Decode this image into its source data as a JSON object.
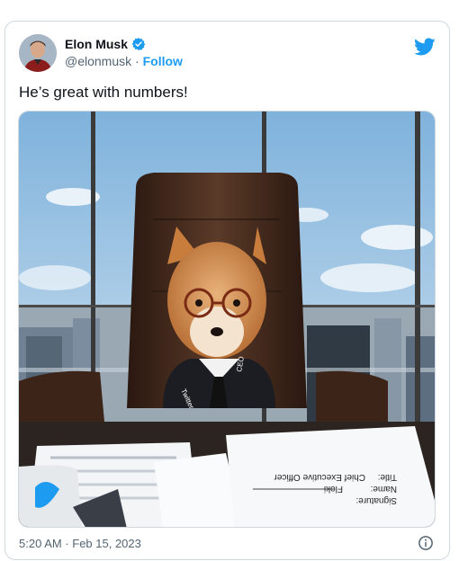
{
  "author": {
    "display_name": "Elon Musk",
    "handle": "@elonmusk",
    "separator": " · ",
    "follow_label": "Follow"
  },
  "tweet": {
    "text": "He’s great with numbers!",
    "timestamp": "5:20 AM · Feb 15, 2023"
  },
  "media": {
    "icons": [
      "verified-badge-icon",
      "twitter-bird-icon",
      "info-icon"
    ],
    "tie_label_left": "Twitter",
    "tie_label_right": "CEO",
    "paper_lines": [
      "Signature:",
      "Name:",
      "Title:",
      "Floki",
      "Chief Executive Officer"
    ]
  },
  "colors": {
    "accent": "#1d9bf0",
    "text": "#0f1419",
    "secondary": "#536471",
    "border": "#cfd9de"
  }
}
